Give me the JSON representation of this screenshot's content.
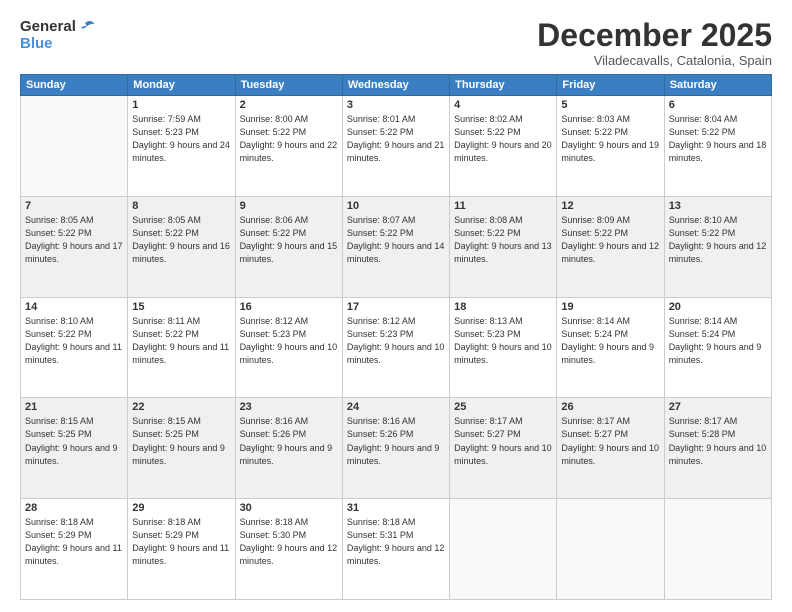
{
  "logo": {
    "general": "General",
    "blue": "Blue"
  },
  "title": "December 2025",
  "location": "Viladecavalls, Catalonia, Spain",
  "weekdays": [
    "Sunday",
    "Monday",
    "Tuesday",
    "Wednesday",
    "Thursday",
    "Friday",
    "Saturday"
  ],
  "weeks": [
    [
      {
        "day": "",
        "sunrise": "",
        "sunset": "",
        "daylight": "",
        "empty": true
      },
      {
        "day": "1",
        "sunrise": "Sunrise: 7:59 AM",
        "sunset": "Sunset: 5:23 PM",
        "daylight": "Daylight: 9 hours and 24 minutes."
      },
      {
        "day": "2",
        "sunrise": "Sunrise: 8:00 AM",
        "sunset": "Sunset: 5:22 PM",
        "daylight": "Daylight: 9 hours and 22 minutes."
      },
      {
        "day": "3",
        "sunrise": "Sunrise: 8:01 AM",
        "sunset": "Sunset: 5:22 PM",
        "daylight": "Daylight: 9 hours and 21 minutes."
      },
      {
        "day": "4",
        "sunrise": "Sunrise: 8:02 AM",
        "sunset": "Sunset: 5:22 PM",
        "daylight": "Daylight: 9 hours and 20 minutes."
      },
      {
        "day": "5",
        "sunrise": "Sunrise: 8:03 AM",
        "sunset": "Sunset: 5:22 PM",
        "daylight": "Daylight: 9 hours and 19 minutes."
      },
      {
        "day": "6",
        "sunrise": "Sunrise: 8:04 AM",
        "sunset": "Sunset: 5:22 PM",
        "daylight": "Daylight: 9 hours and 18 minutes."
      }
    ],
    [
      {
        "day": "7",
        "sunrise": "Sunrise: 8:05 AM",
        "sunset": "Sunset: 5:22 PM",
        "daylight": "Daylight: 9 hours and 17 minutes."
      },
      {
        "day": "8",
        "sunrise": "Sunrise: 8:05 AM",
        "sunset": "Sunset: 5:22 PM",
        "daylight": "Daylight: 9 hours and 16 minutes."
      },
      {
        "day": "9",
        "sunrise": "Sunrise: 8:06 AM",
        "sunset": "Sunset: 5:22 PM",
        "daylight": "Daylight: 9 hours and 15 minutes."
      },
      {
        "day": "10",
        "sunrise": "Sunrise: 8:07 AM",
        "sunset": "Sunset: 5:22 PM",
        "daylight": "Daylight: 9 hours and 14 minutes."
      },
      {
        "day": "11",
        "sunrise": "Sunrise: 8:08 AM",
        "sunset": "Sunset: 5:22 PM",
        "daylight": "Daylight: 9 hours and 13 minutes."
      },
      {
        "day": "12",
        "sunrise": "Sunrise: 8:09 AM",
        "sunset": "Sunset: 5:22 PM",
        "daylight": "Daylight: 9 hours and 12 minutes."
      },
      {
        "day": "13",
        "sunrise": "Sunrise: 8:10 AM",
        "sunset": "Sunset: 5:22 PM",
        "daylight": "Daylight: 9 hours and 12 minutes."
      }
    ],
    [
      {
        "day": "14",
        "sunrise": "Sunrise: 8:10 AM",
        "sunset": "Sunset: 5:22 PM",
        "daylight": "Daylight: 9 hours and 11 minutes."
      },
      {
        "day": "15",
        "sunrise": "Sunrise: 8:11 AM",
        "sunset": "Sunset: 5:22 PM",
        "daylight": "Daylight: 9 hours and 11 minutes."
      },
      {
        "day": "16",
        "sunrise": "Sunrise: 8:12 AM",
        "sunset": "Sunset: 5:23 PM",
        "daylight": "Daylight: 9 hours and 10 minutes."
      },
      {
        "day": "17",
        "sunrise": "Sunrise: 8:12 AM",
        "sunset": "Sunset: 5:23 PM",
        "daylight": "Daylight: 9 hours and 10 minutes."
      },
      {
        "day": "18",
        "sunrise": "Sunrise: 8:13 AM",
        "sunset": "Sunset: 5:23 PM",
        "daylight": "Daylight: 9 hours and 10 minutes."
      },
      {
        "day": "19",
        "sunrise": "Sunrise: 8:14 AM",
        "sunset": "Sunset: 5:24 PM",
        "daylight": "Daylight: 9 hours and 9 minutes."
      },
      {
        "day": "20",
        "sunrise": "Sunrise: 8:14 AM",
        "sunset": "Sunset: 5:24 PM",
        "daylight": "Daylight: 9 hours and 9 minutes."
      }
    ],
    [
      {
        "day": "21",
        "sunrise": "Sunrise: 8:15 AM",
        "sunset": "Sunset: 5:25 PM",
        "daylight": "Daylight: 9 hours and 9 minutes."
      },
      {
        "day": "22",
        "sunrise": "Sunrise: 8:15 AM",
        "sunset": "Sunset: 5:25 PM",
        "daylight": "Daylight: 9 hours and 9 minutes."
      },
      {
        "day": "23",
        "sunrise": "Sunrise: 8:16 AM",
        "sunset": "Sunset: 5:26 PM",
        "daylight": "Daylight: 9 hours and 9 minutes."
      },
      {
        "day": "24",
        "sunrise": "Sunrise: 8:16 AM",
        "sunset": "Sunset: 5:26 PM",
        "daylight": "Daylight: 9 hours and 9 minutes."
      },
      {
        "day": "25",
        "sunrise": "Sunrise: 8:17 AM",
        "sunset": "Sunset: 5:27 PM",
        "daylight": "Daylight: 9 hours and 10 minutes."
      },
      {
        "day": "26",
        "sunrise": "Sunrise: 8:17 AM",
        "sunset": "Sunset: 5:27 PM",
        "daylight": "Daylight: 9 hours and 10 minutes."
      },
      {
        "day": "27",
        "sunrise": "Sunrise: 8:17 AM",
        "sunset": "Sunset: 5:28 PM",
        "daylight": "Daylight: 9 hours and 10 minutes."
      }
    ],
    [
      {
        "day": "28",
        "sunrise": "Sunrise: 8:18 AM",
        "sunset": "Sunset: 5:29 PM",
        "daylight": "Daylight: 9 hours and 11 minutes."
      },
      {
        "day": "29",
        "sunrise": "Sunrise: 8:18 AM",
        "sunset": "Sunset: 5:29 PM",
        "daylight": "Daylight: 9 hours and 11 minutes."
      },
      {
        "day": "30",
        "sunrise": "Sunrise: 8:18 AM",
        "sunset": "Sunset: 5:30 PM",
        "daylight": "Daylight: 9 hours and 12 minutes."
      },
      {
        "day": "31",
        "sunrise": "Sunrise: 8:18 AM",
        "sunset": "Sunset: 5:31 PM",
        "daylight": "Daylight: 9 hours and 12 minutes."
      },
      {
        "day": "",
        "sunrise": "",
        "sunset": "",
        "daylight": "",
        "empty": true
      },
      {
        "day": "",
        "sunrise": "",
        "sunset": "",
        "daylight": "",
        "empty": true
      },
      {
        "day": "",
        "sunrise": "",
        "sunset": "",
        "daylight": "",
        "empty": true
      }
    ]
  ]
}
